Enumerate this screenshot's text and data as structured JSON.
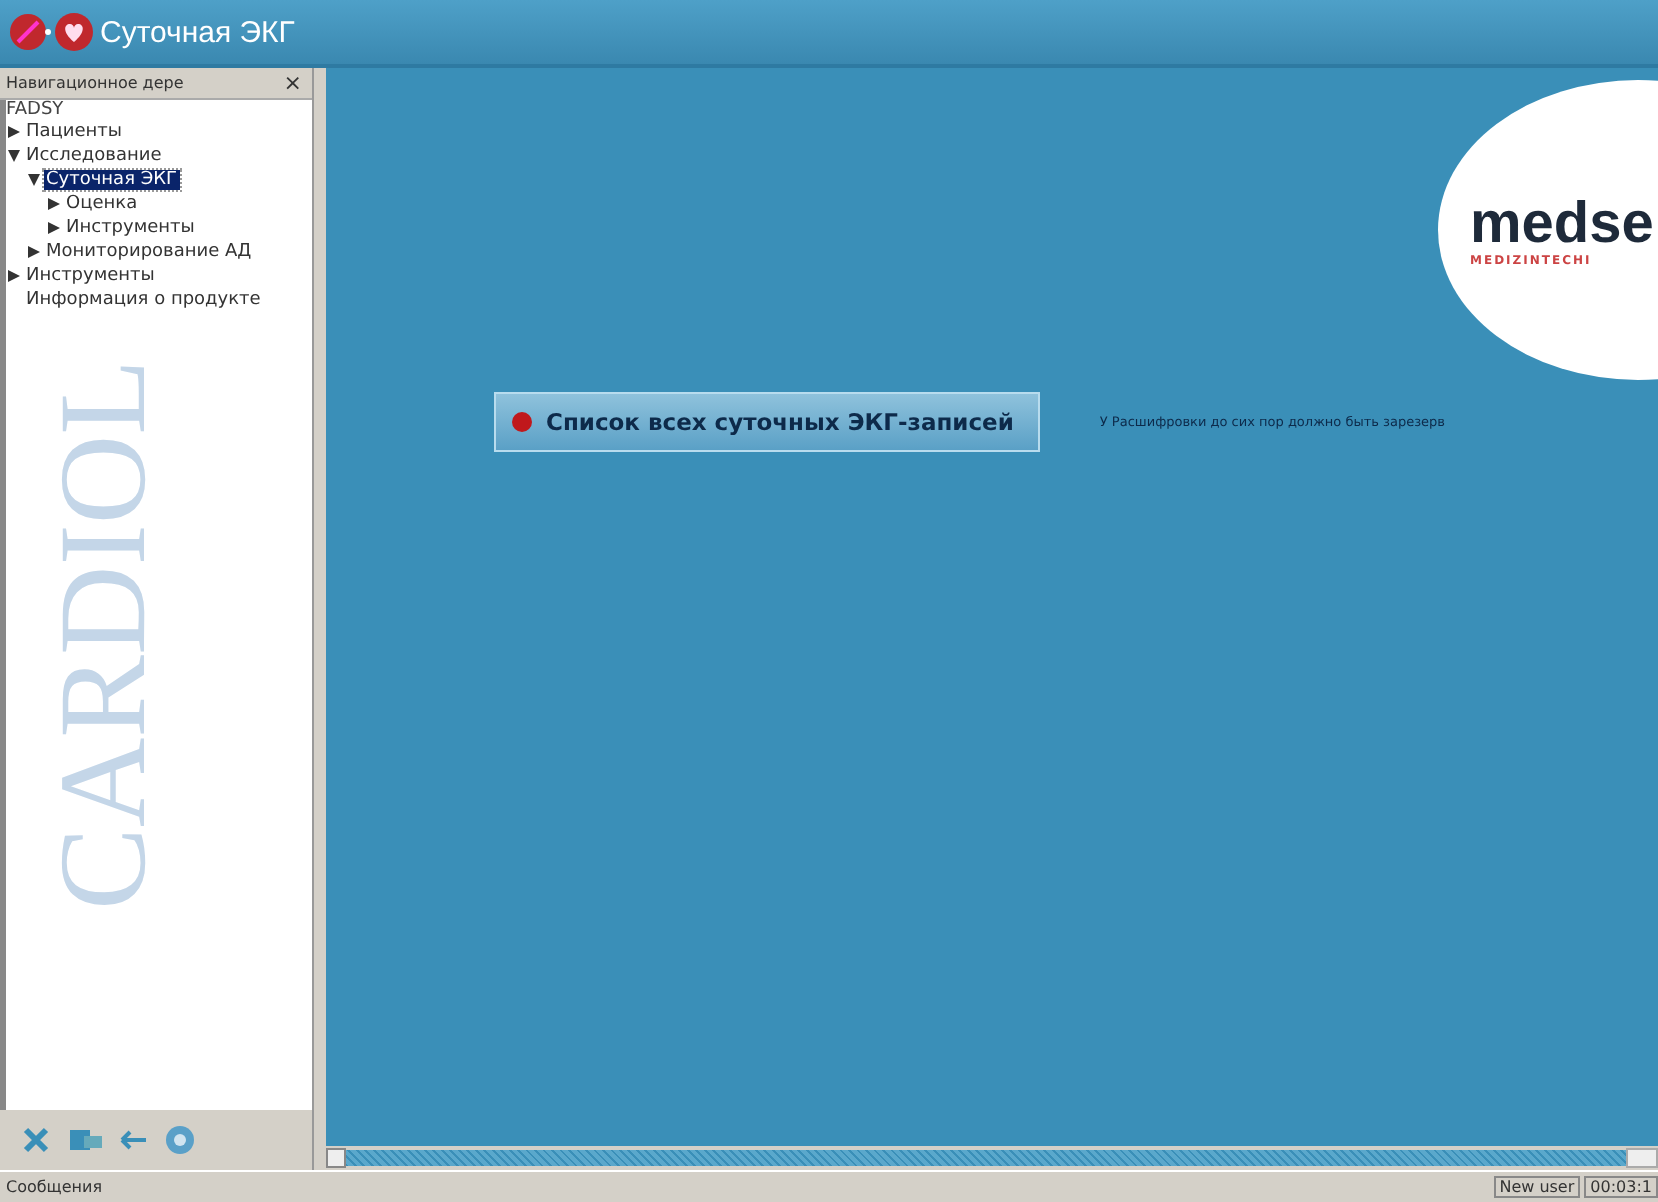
{
  "window": {
    "title": "Суточная ЭКГ"
  },
  "navigation": {
    "title": "Навигационное дере",
    "close": "×",
    "root": "FADSY",
    "watermark": "CARDIOL",
    "items": [
      {
        "label": "Пациенты",
        "expanded": false,
        "selected": false
      },
      {
        "label": "Исследование",
        "expanded": true,
        "selected": false,
        "children": [
          {
            "label": "Суточная ЭКГ",
            "expanded": true,
            "selected": true,
            "children": [
              {
                "label": "Оценка",
                "expanded": false,
                "selected": false
              },
              {
                "label": "Инструменты",
                "expanded": false,
                "selected": false
              }
            ]
          },
          {
            "label": "Мониторирование АД",
            "expanded": false,
            "selected": false
          }
        ]
      },
      {
        "label": "Инструменты",
        "expanded": false,
        "selected": false
      },
      {
        "label": "Информация о продукте",
        "selected": false
      }
    ]
  },
  "main": {
    "button": "Список всех суточных ЭКГ-записей",
    "note": "У Расшифровки до сих пор должно быть зарезерв",
    "logo": {
      "name": "medse",
      "tagline": "MEDIZINTECHI"
    }
  },
  "status_bar": {
    "message": "Сообщения",
    "user": "New user",
    "time": "00:03:1"
  }
}
